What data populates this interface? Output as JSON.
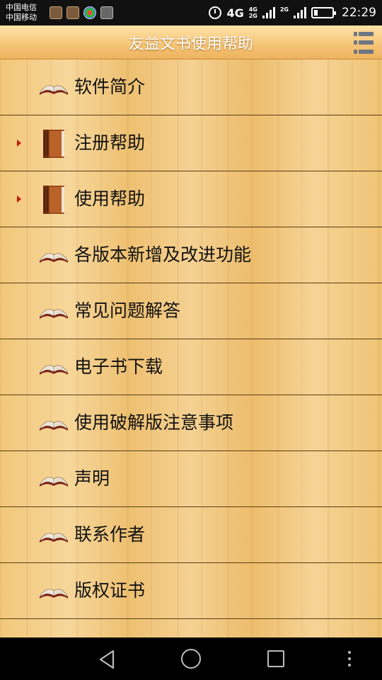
{
  "status_bar": {
    "carrier_1": "中国电信",
    "carrier_2": "中国移动",
    "network_main": "4G",
    "network_small_1": "4G",
    "network_small_2": "2G",
    "network_secondary": "2G",
    "time": "22:29"
  },
  "header": {
    "title": "友益文书使用帮助"
  },
  "menu": {
    "items": [
      {
        "label": "软件简介",
        "icon": "open-book-icon",
        "expandable": false
      },
      {
        "label": "注册帮助",
        "icon": "closed-book-icon",
        "expandable": true
      },
      {
        "label": "使用帮助",
        "icon": "closed-book-icon",
        "expandable": true
      },
      {
        "label": "各版本新增及改进功能",
        "icon": "open-book-icon",
        "expandable": false
      },
      {
        "label": "常见问题解答",
        "icon": "open-book-icon",
        "expandable": false
      },
      {
        "label": "电子书下载",
        "icon": "open-book-icon",
        "expandable": false
      },
      {
        "label": "使用破解版注意事项",
        "icon": "open-book-icon",
        "expandable": false
      },
      {
        "label": "声明",
        "icon": "open-book-icon",
        "expandable": false
      },
      {
        "label": "联系作者",
        "icon": "open-book-icon",
        "expandable": false
      },
      {
        "label": "版权证书",
        "icon": "open-book-icon",
        "expandable": false
      }
    ]
  },
  "colors": {
    "expand_arrow": "#c41d12",
    "divider": "#5b3d17",
    "title_text": "#ffffff"
  }
}
